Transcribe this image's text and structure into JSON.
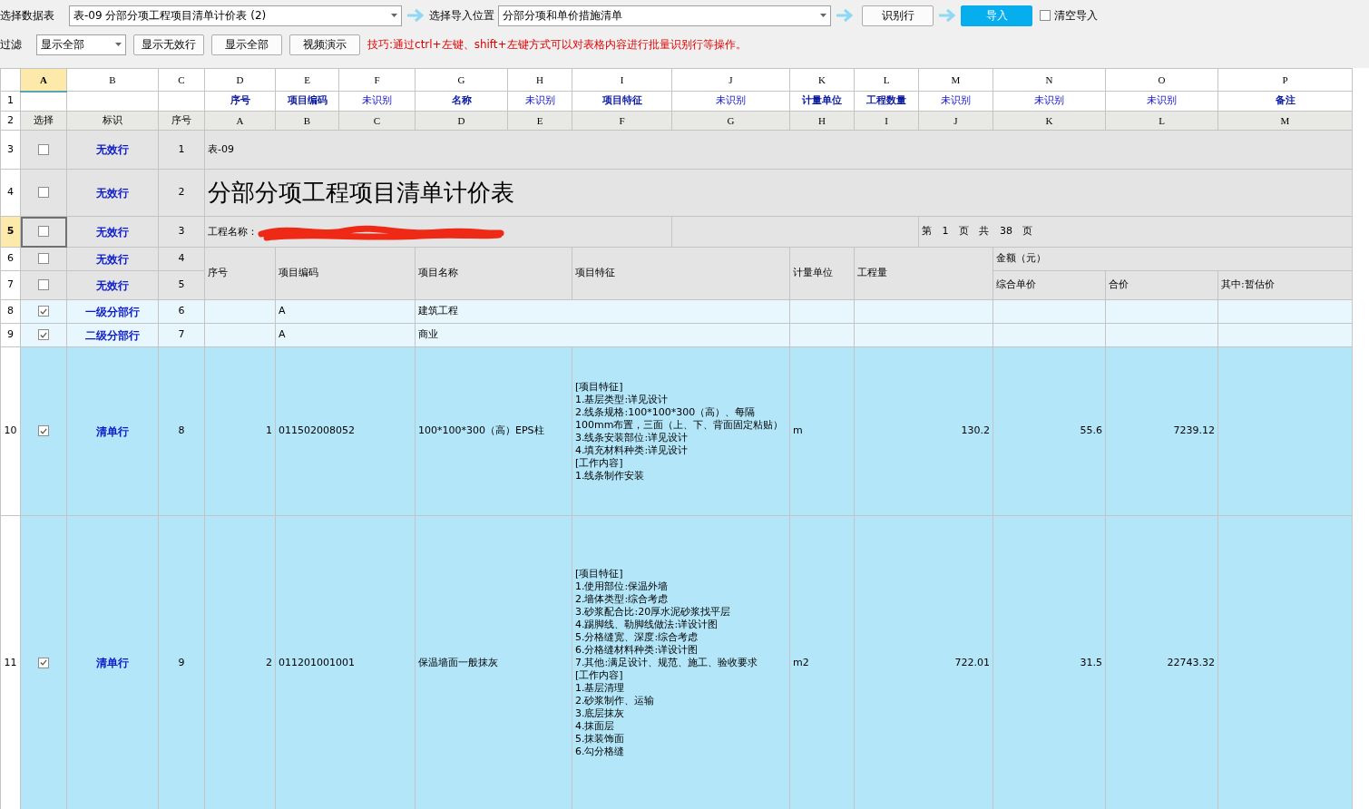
{
  "toolbar": {
    "data_table": {
      "label": "选择数据表",
      "value": "表-09 分部分项工程项目清单计价表 (2)"
    },
    "import_position": {
      "label": "选择导入位置",
      "value": "分部分项和单价措施清单"
    },
    "identify_button": "识别行",
    "import_button": "导入",
    "clear_import": {
      "label": "清空导入",
      "checked": false
    }
  },
  "filter": {
    "label": "过滤",
    "value": "显示全部",
    "buttons": [
      "显示无效行",
      "显示全部",
      "视频演示"
    ],
    "tip": "技巧:通过ctrl+左键、shift+左键方式可以对表格内容进行批量识别行等操作。"
  },
  "grid": {
    "column_headers": [
      {
        "label": "A",
        "selected": true
      },
      {
        "label": "B",
        "selected": false
      },
      {
        "label": "C",
        "selected": false
      },
      {
        "label": "D",
        "selected": false
      },
      {
        "label": "E",
        "selected": false
      },
      {
        "label": "F",
        "selected": false
      },
      {
        "label": "G",
        "selected": false
      },
      {
        "label": "H",
        "selected": false
      },
      {
        "label": "I",
        "selected": false
      },
      {
        "label": "J",
        "selected": false
      },
      {
        "label": "K",
        "selected": false
      },
      {
        "label": "L",
        "selected": false
      },
      {
        "label": "M",
        "selected": false
      },
      {
        "label": "N",
        "selected": false
      },
      {
        "label": "O",
        "selected": false
      },
      {
        "label": "P",
        "selected": false
      }
    ],
    "mapping_row": {
      "number": "1",
      "cells": [
        {
          "label": "序号",
          "recognized": true
        },
        {
          "label": "项目编码",
          "recognized": true
        },
        {
          "label": "未识别",
          "recognized": false
        },
        {
          "label": "名称",
          "recognized": true
        },
        {
          "label": "未识别",
          "recognized": false
        },
        {
          "label": "项目特征",
          "recognized": true
        },
        {
          "label": "未识别",
          "recognized": false
        },
        {
          "label": "计量单位",
          "recognized": true
        },
        {
          "label": "工程数量",
          "recognized": true
        },
        {
          "label": "未识别",
          "recognized": false
        },
        {
          "label": "未识别",
          "recognized": false
        },
        {
          "label": "未识别",
          "recognized": false
        },
        {
          "label": "备注",
          "recognized": true
        }
      ]
    },
    "source_row": {
      "number": "2",
      "labels": [
        "选择",
        "标识",
        "序号"
      ],
      "cells": [
        "A",
        "B",
        "C",
        "D",
        "E",
        "F",
        "G",
        "H",
        "I",
        "J",
        "K",
        "L",
        "M"
      ]
    },
    "rows": [
      {
        "number": "3",
        "selected": false,
        "checked": false,
        "tag": "无效行",
        "seq": "1",
        "kind": "caption",
        "text": "表-09"
      },
      {
        "number": "4",
        "selected": false,
        "checked": false,
        "tag": "无效行",
        "seq": "2",
        "kind": "title",
        "text": "分部分项工程项目清单计价表"
      },
      {
        "number": "5",
        "selected": true,
        "checked": false,
        "tag": "无效行",
        "seq": "3",
        "kind": "project",
        "label": "工程名称：",
        "redacted": true,
        "page": "第 1 页 共 38 页"
      },
      {
        "number": "6",
        "selected": false,
        "checked": false,
        "tag": "无效行",
        "seq": "4",
        "kind": "header",
        "columns": [
          "序号",
          "项目编码",
          "项目名称",
          "项目特征",
          "计量单位",
          "工程量"
        ],
        "amount": "金额（元）"
      },
      {
        "number": "7",
        "selected": false,
        "checked": false,
        "tag": "无效行",
        "seq": "5",
        "kind": "subheader",
        "columns": [
          "综合单价",
          "合价",
          "其中:暂估价"
        ]
      },
      {
        "number": "8",
        "selected": false,
        "checked": true,
        "tag": "一级分部行",
        "seq": "6",
        "kind": "section",
        "code": "A",
        "name": "建筑工程"
      },
      {
        "number": "9",
        "selected": false,
        "checked": true,
        "tag": "二级分部行",
        "seq": "7",
        "kind": "section",
        "code": "A",
        "name": "商业"
      },
      {
        "number": "10",
        "selected": false,
        "checked": true,
        "tag": "清单行",
        "seq": "8",
        "kind": "item",
        "index": "1",
        "code": "011502008052",
        "name": "100*100*300（高）EPS柱",
        "features": [
          "[项目特征]",
          "1.基层类型:详见设计",
          "2.线条规格:100*100*300（高）、每隔100mm布置，三面（上、下、背面固定粘贴）",
          "3.线条安装部位:详见设计",
          "4.填充材料种类:详见设计",
          "[工作内容]",
          "1.线条制作安装"
        ],
        "unit": "m",
        "quantity": "130.2",
        "unit_price": "55.6",
        "total": "7239.12"
      },
      {
        "number": "11",
        "selected": false,
        "checked": true,
        "tag": "清单行",
        "seq": "9",
        "kind": "item",
        "index": "2",
        "code": "011201001001",
        "name": "保温墙面一般抹灰",
        "features": [
          "[项目特征]",
          "1.使用部位:保温外墙",
          "2.墙体类型:综合考虑",
          "3.砂浆配合比:20厚水泥砂浆找平层",
          "4.踢脚线、勒脚线做法:详设计图",
          "5.分格缝宽、深度:综合考虑",
          "6.分格缝材料种类:详设计图",
          "7.其他:满足设计、规范、施工、验收要求",
          "[工作内容]",
          "1.基层清理",
          "2.砂浆制作、运输",
          "3.底层抹灰",
          "4.抹面层",
          "5.抹装饰面",
          "6.勾分格缝"
        ],
        "unit": "m2",
        "quantity": "722.01",
        "unit_price": "31.5",
        "total": "22743.32"
      }
    ]
  }
}
